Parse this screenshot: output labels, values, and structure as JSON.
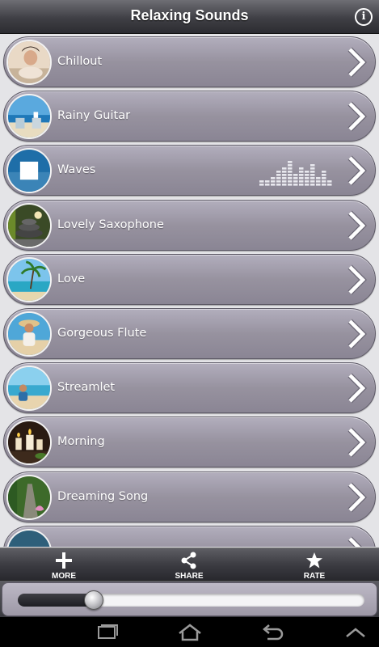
{
  "header": {
    "title": "Relaxing Sounds",
    "info_icon": "info-icon"
  },
  "sounds": [
    {
      "label": "Chillout",
      "thumb": "spa-woman",
      "playing": false
    },
    {
      "label": "Rainy Guitar",
      "thumb": "beach-chairs",
      "playing": false
    },
    {
      "label": "Waves",
      "thumb": "stop",
      "playing": true
    },
    {
      "label": "Lovely Saxophone",
      "thumb": "zen-stones",
      "playing": false
    },
    {
      "label": "Love",
      "thumb": "palm-island",
      "playing": false
    },
    {
      "label": "Gorgeous Flute",
      "thumb": "woman-hat",
      "playing": false
    },
    {
      "label": "Streamlet",
      "thumb": "beach-woman",
      "playing": false
    },
    {
      "label": "Morning",
      "thumb": "candles",
      "playing": false
    },
    {
      "label": "Dreaming Song",
      "thumb": "lotus-path",
      "playing": false
    },
    {
      "label": "",
      "thumb": "sea-partial",
      "playing": false
    }
  ],
  "toolbar": {
    "more": "MORE",
    "share": "SHARE",
    "rate": "RATE"
  },
  "player": {
    "progress": 0.22
  },
  "colors": {
    "row_top": "#b2aebd",
    "row_bottom": "#8a8594",
    "header": "#3f3f45"
  },
  "icons": [
    "info-icon",
    "chevron-right-icon",
    "equalizer-icon",
    "plus-icon",
    "share-icon",
    "star-icon",
    "recent-apps-icon",
    "home-icon",
    "back-icon",
    "up-icon"
  ]
}
